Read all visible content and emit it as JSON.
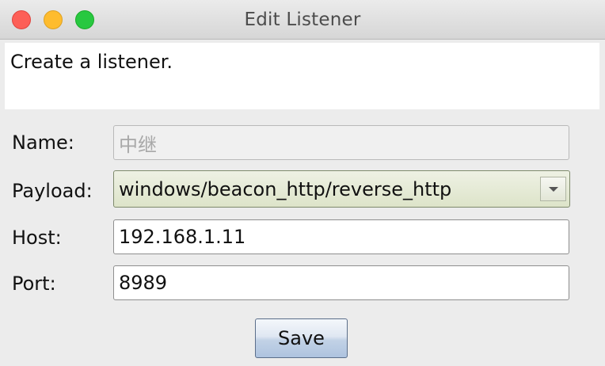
{
  "window": {
    "title": "Edit Listener"
  },
  "description": {
    "text": "Create a listener."
  },
  "form": {
    "name": {
      "label": "Name:",
      "value": "中继",
      "disabled": true
    },
    "payload": {
      "label": "Payload:",
      "selected": "windows/beacon_http/reverse_http"
    },
    "host": {
      "label": "Host:",
      "value": "192.168.1.11"
    },
    "port": {
      "label": "Port:",
      "value": "8989"
    }
  },
  "buttons": {
    "save_label": "Save"
  },
  "colors": {
    "close": "#fd5f57",
    "minimize": "#febc2e",
    "zoom": "#28c840"
  }
}
